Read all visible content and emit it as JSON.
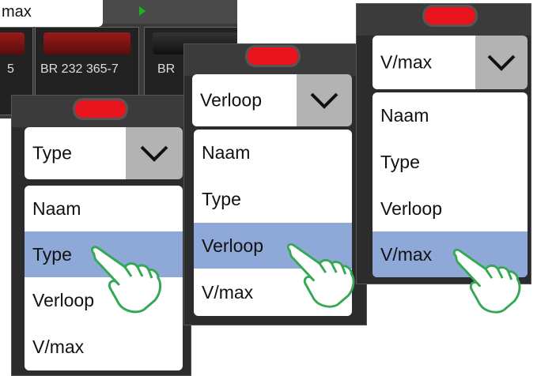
{
  "background": {
    "selector_value": "max",
    "cards": [
      {
        "caption": "5"
      },
      {
        "caption": "BR 232 365-7"
      },
      {
        "caption": "BR"
      }
    ]
  },
  "panels": [
    {
      "selected": "Type",
      "items": [
        "Naam",
        "Type",
        "Verloop",
        "V/max"
      ],
      "highlighted_index": 1
    },
    {
      "selected": "Verloop",
      "items": [
        "Naam",
        "Type",
        "Verloop",
        "V/max"
      ],
      "highlighted_index": 2
    },
    {
      "selected": "V/max",
      "items": [
        "Naam",
        "Type",
        "Verloop",
        "V/max"
      ],
      "highlighted_index": 3
    }
  ],
  "colors": {
    "highlight": "#8ea9d8",
    "handle": "#e8131c",
    "hand_outline": "#34a853"
  },
  "icons": {
    "dropdown": "chevron-down-icon",
    "pointer": "pointing-hand-icon"
  }
}
